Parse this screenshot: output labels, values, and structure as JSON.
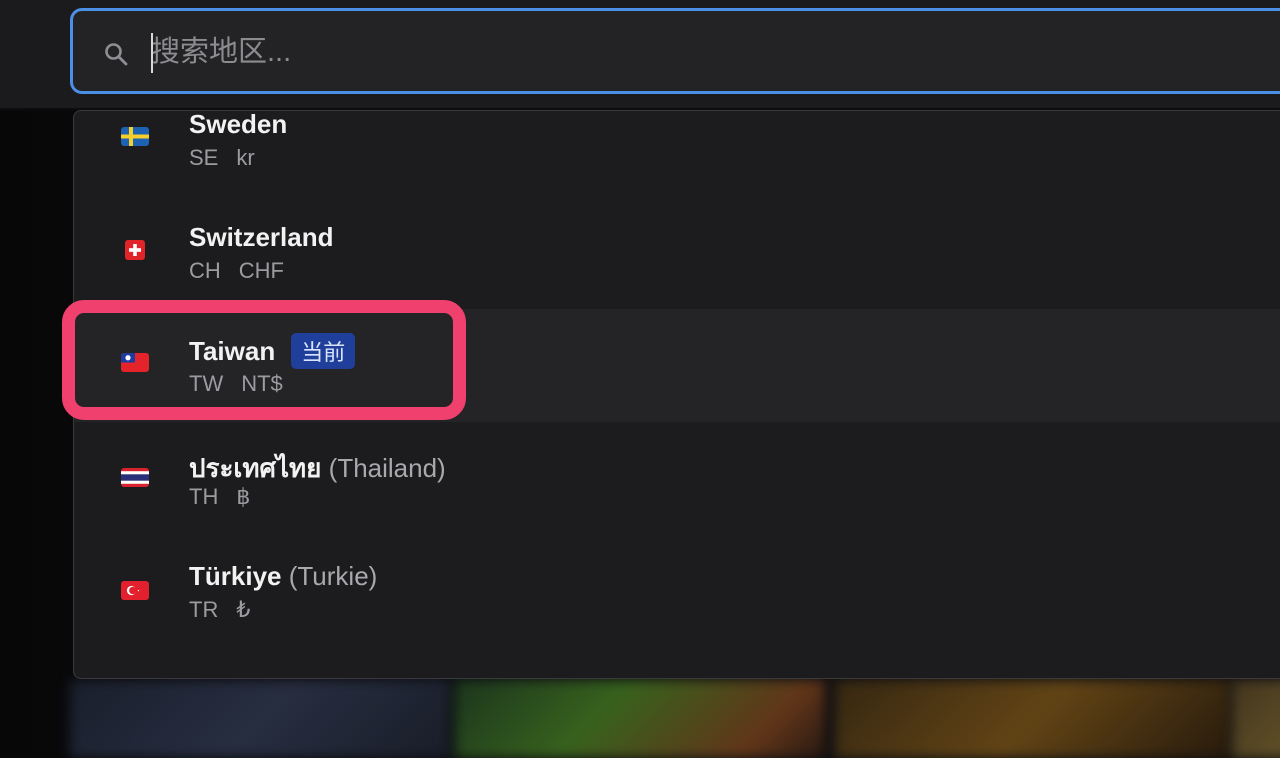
{
  "search": {
    "placeholder": "搜索地区..."
  },
  "colors": {
    "accent_border": "#4b8fe6",
    "badge_bg": "#1f3f9a",
    "highlight": "#f0406e"
  },
  "regions": [
    {
      "name": "Sweden",
      "native_suffix": "",
      "code": "SE",
      "currency": "kr",
      "flag_icon": "sweden-flag-icon",
      "current": false
    },
    {
      "name": "Switzerland",
      "native_suffix": "",
      "code": "CH",
      "currency": "CHF",
      "flag_icon": "switzerland-flag-icon",
      "current": false
    },
    {
      "name": "Taiwan",
      "native_suffix": "",
      "code": "TW",
      "currency": "NT$",
      "flag_icon": "taiwan-flag-icon",
      "current": true,
      "badge": "当前"
    },
    {
      "name": "ประเทศไทย",
      "native_suffix": "(Thailand)",
      "code": "TH",
      "currency": "฿",
      "flag_icon": "thailand-flag-icon",
      "current": false
    },
    {
      "name": "Türkiye",
      "native_suffix": "(Turkie)",
      "code": "TR",
      "currency": "₺",
      "flag_icon": "turkey-flag-icon",
      "current": false
    }
  ]
}
